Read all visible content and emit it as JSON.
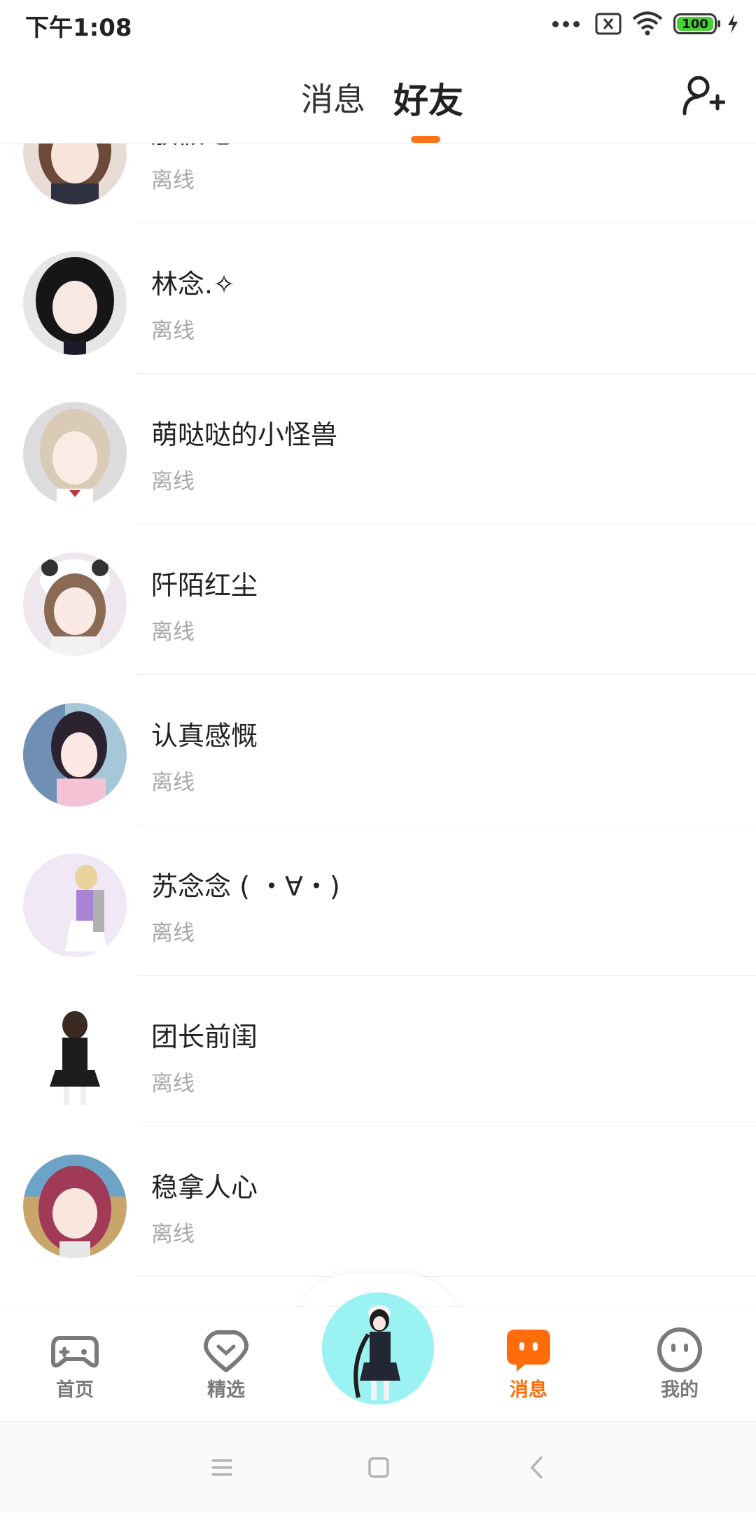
{
  "status_bar": {
    "time": "下午1:08",
    "battery": "100"
  },
  "header": {
    "tabs": [
      {
        "label": "消息",
        "active": false
      },
      {
        "label": "好友",
        "active": true
      }
    ],
    "accent": "#ff7416"
  },
  "friends": [
    {
      "name": "放假吧!!!",
      "status": "离线",
      "avatar_color": "#6b4a3a",
      "bg": "#e9dcd6"
    },
    {
      "name": "林念.✧",
      "status": "离线",
      "avatar_color": "#161616",
      "bg": "#e6e6e6"
    },
    {
      "name": "萌哒哒的小怪兽",
      "status": "离线",
      "avatar_color": "#d9cbb6",
      "bg": "#dcdcdc"
    },
    {
      "name": "阡陌红尘",
      "status": "离线",
      "avatar_color": "#8b6a55",
      "bg": "#efe7ee"
    },
    {
      "name": "认真感慨",
      "status": "离线",
      "avatar_color": "#2b2430",
      "bg": "#a6c7d8"
    },
    {
      "name": "苏念念 ( ・∀・)",
      "status": "离线",
      "avatar_color": "#e8d39a",
      "bg": "#f1e8f6"
    },
    {
      "name": "团长前闺",
      "status": "离线",
      "avatar_color": "#1d1d1d",
      "bg": "#ffffff"
    },
    {
      "name": "稳拿人心",
      "status": "离线",
      "avatar_color": "#a03a56",
      "bg": "#c9a46b"
    }
  ],
  "bottom_nav": {
    "items": [
      {
        "label": "首页",
        "icon": "gamepad-icon",
        "active": false
      },
      {
        "label": "精选",
        "icon": "heart-badge-icon",
        "active": false
      },
      {
        "label": "消息",
        "icon": "message-bubble-icon",
        "active": true
      },
      {
        "label": "我的",
        "icon": "face-icon",
        "active": false
      }
    ],
    "active_color": "#ff6d0a"
  }
}
